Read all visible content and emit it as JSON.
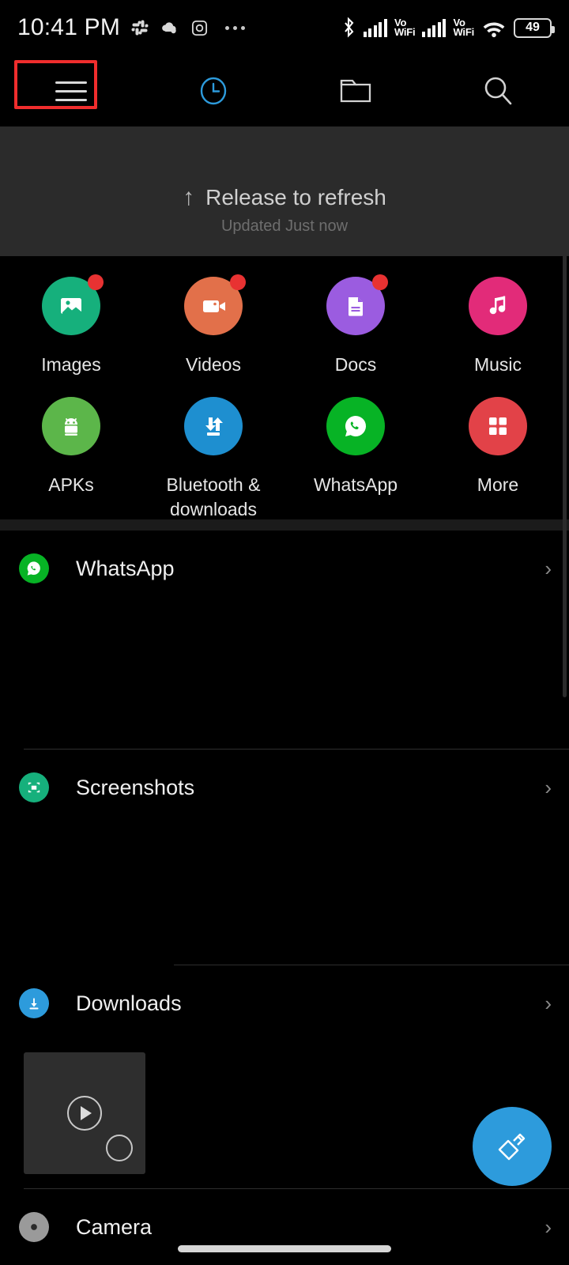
{
  "status_bar": {
    "time": "10:41 PM",
    "left_icons": [
      "slack-icon",
      "cloud-icon",
      "instagram-icon",
      "overflow-dots-icon"
    ],
    "right_icons": [
      "bluetooth-icon",
      "signal-bars-icon",
      "vowifi-label",
      "signal-bars-icon",
      "vowifi-label",
      "wifi-icon",
      "battery-icon"
    ],
    "vowifi_line1": "Vo",
    "vowifi_line2": "WiFi",
    "battery_level": "49"
  },
  "toolbar": {
    "items": [
      {
        "name": "menu",
        "icon": "hamburger-menu-icon",
        "active": false,
        "highlighted": true
      },
      {
        "name": "recent",
        "icon": "clock-icon",
        "active": true,
        "highlighted": false
      },
      {
        "name": "folders",
        "icon": "folder-icon",
        "active": false,
        "highlighted": false
      },
      {
        "name": "search",
        "icon": "search-icon",
        "active": false,
        "highlighted": false
      }
    ],
    "active_color": "#2d9bdc",
    "inactive_color": "#d9d9d9"
  },
  "refresh": {
    "arrow": "↑",
    "label": "Release to refresh",
    "sub_label": "Updated Just now"
  },
  "categories": [
    {
      "label": "Images",
      "icon": "photo-icon",
      "color": "#16b07c",
      "badge": true
    },
    {
      "label": "Videos",
      "icon": "video-camera-icon",
      "color": "#e2704a",
      "badge": true
    },
    {
      "label": "Docs",
      "icon": "document-icon",
      "color": "#9b5ce0",
      "badge": true
    },
    {
      "label": "Music",
      "icon": "music-note-icon",
      "color": "#e22b79",
      "badge": false
    },
    {
      "label": "APKs",
      "icon": "android-robot-icon",
      "color": "#5cb64a",
      "badge": false
    },
    {
      "label": "Bluetooth &\ndownloads",
      "icon": "transfer-arrows-icon",
      "color": "#1e8fd0",
      "badge": false
    },
    {
      "label": "WhatsApp",
      "icon": "whatsapp-icon",
      "color": "#07b325",
      "badge": false
    },
    {
      "label": "More",
      "icon": "grid-four-icon",
      "color": "#e24248",
      "badge": false
    }
  ],
  "file_groups": [
    {
      "label": "WhatsApp",
      "icon": "whatsapp-icon",
      "icon_color": "#07b325",
      "chevron": "›"
    },
    {
      "label": "Screenshots",
      "icon": "screenshot-frame-icon",
      "icon_color": "#16b07c",
      "chevron": "›"
    },
    {
      "label": "Downloads",
      "icon": "download-arrow-icon",
      "icon_color": "#2d9bdc",
      "chevron": "›"
    },
    {
      "label": "Camera",
      "icon": "camera-icon",
      "icon_color": "#9a9a9a",
      "chevron": "›"
    }
  ],
  "thumbnail": {
    "type": "video",
    "play_icon": "play-icon",
    "select_icon": "selection-circle-icon",
    "selected": false
  },
  "fab": {
    "icon": "cleaner-brush-icon",
    "color": "#2d9bdc"
  },
  "colors": {
    "background": "#000000",
    "panel": "#2b2b2b",
    "divider": "#2e2e2e",
    "accent": "#2d9bdc",
    "badge": "#e83232",
    "highlight_box": "#f02d2d"
  }
}
